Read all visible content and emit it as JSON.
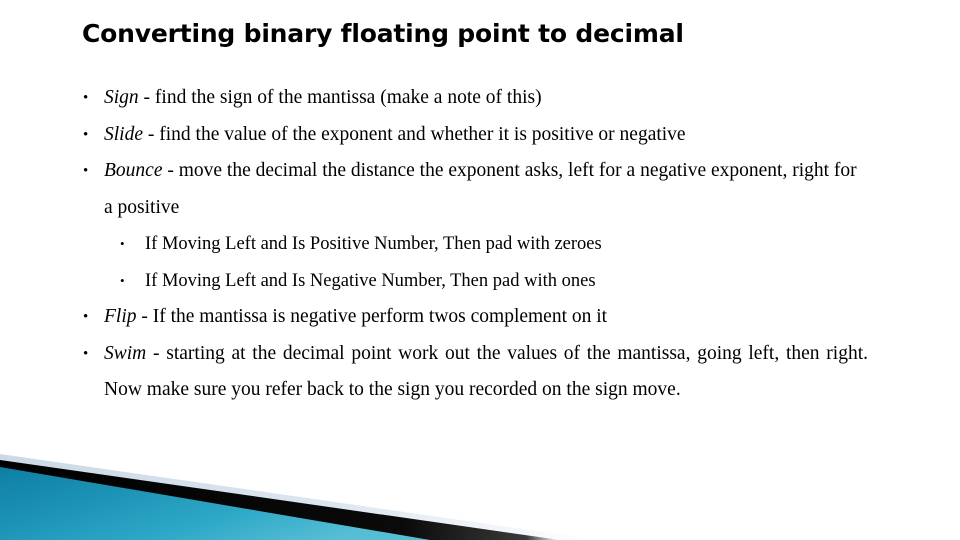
{
  "slide": {
    "title": "Converting binary floating point to decimal",
    "bullets": [
      {
        "level": 1,
        "marker": "•",
        "keyword": "Sign",
        "text": " - find the sign of the mantissa (make a note of this)",
        "justified": false
      },
      {
        "level": 1,
        "marker": "•",
        "keyword": "Slide",
        "text": " - find the value of the exponent and whether it is positive or negative",
        "justified": false
      },
      {
        "level": 1,
        "marker": "•",
        "keyword": "Bounce",
        "text": " - move the decimal the distance the exponent asks, left for a negative exponent, right for a positive",
        "justified": false
      },
      {
        "level": 2,
        "marker": "•",
        "keyword": "",
        "text": "If Moving Left and Is Positive Number, Then pad with zeroes",
        "justified": false
      },
      {
        "level": 2,
        "marker": "•",
        "keyword": "",
        "text": "If Moving Left and Is Negative Number, Then pad with ones",
        "justified": false
      },
      {
        "level": 1,
        "marker": "•",
        "keyword": "Flip",
        "text": " - If the mantissa is negative perform twos complement on it",
        "justified": false
      },
      {
        "level": 1,
        "marker": "•",
        "keyword": "Swim",
        "text": " - starting at the decimal point work out the values of the mantissa, going left, then right. Now make sure you refer back to the sign you recorded on the sign move.",
        "justified": true
      }
    ],
    "footer_art": {
      "name": "diagonal-band-decoration",
      "teal_color_light": "#2FA9C8",
      "teal_color_dark": "#0E7FA3",
      "stripe_color": "#050505",
      "pale_band_color": "#DCE6EF",
      "background_color": "#FFFFFF"
    }
  }
}
